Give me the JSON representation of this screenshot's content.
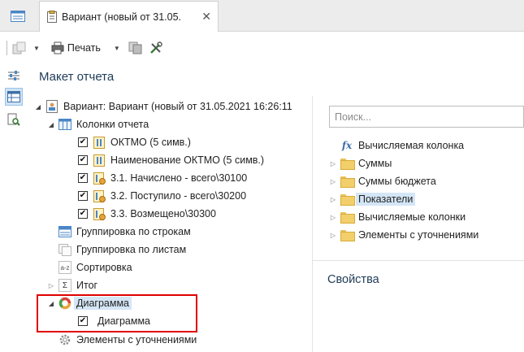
{
  "tab": {
    "title": "Вариант (новый от 31.05.",
    "close": "✕"
  },
  "toolbar": {
    "print_label": "Печать"
  },
  "panel": {
    "title": "Макет отчета"
  },
  "tree": {
    "variant": "Вариант: Вариант (новый от 31.05.2021 16:26:11",
    "columns": "Колонки отчета",
    "col_items": [
      "ОКТМО (5 симв.)",
      "Наименование ОКТМО (5 симв.)",
      "3.1. Начислено - всего\\30100",
      "3.2. Поступило - всего\\30200",
      "3.3. Возмещено\\30300"
    ],
    "group_rows": "Группировка по строкам",
    "group_sheets": "Группировка по листам",
    "sort": "Сортировка",
    "total": "Итог",
    "chart": "Диаграмма",
    "chart_child": "Диаграмма",
    "refinements": "Элементы с уточнениями",
    "sort_icon_text": "a-z",
    "total_icon_text": "Σ"
  },
  "search": {
    "placeholder": "Поиск..."
  },
  "right_tree": {
    "computed": "Вычисляемая колонка",
    "fx": "fx",
    "folders": [
      "Суммы",
      "Суммы бюджета",
      "Показатели",
      "Вычисляемые колонки",
      "Элементы с уточнениями"
    ]
  },
  "properties": {
    "title": "Свойства"
  },
  "colors": {
    "accent": "#1f3b57",
    "selection": "#d4e6f6",
    "highlight": "#e00000"
  }
}
